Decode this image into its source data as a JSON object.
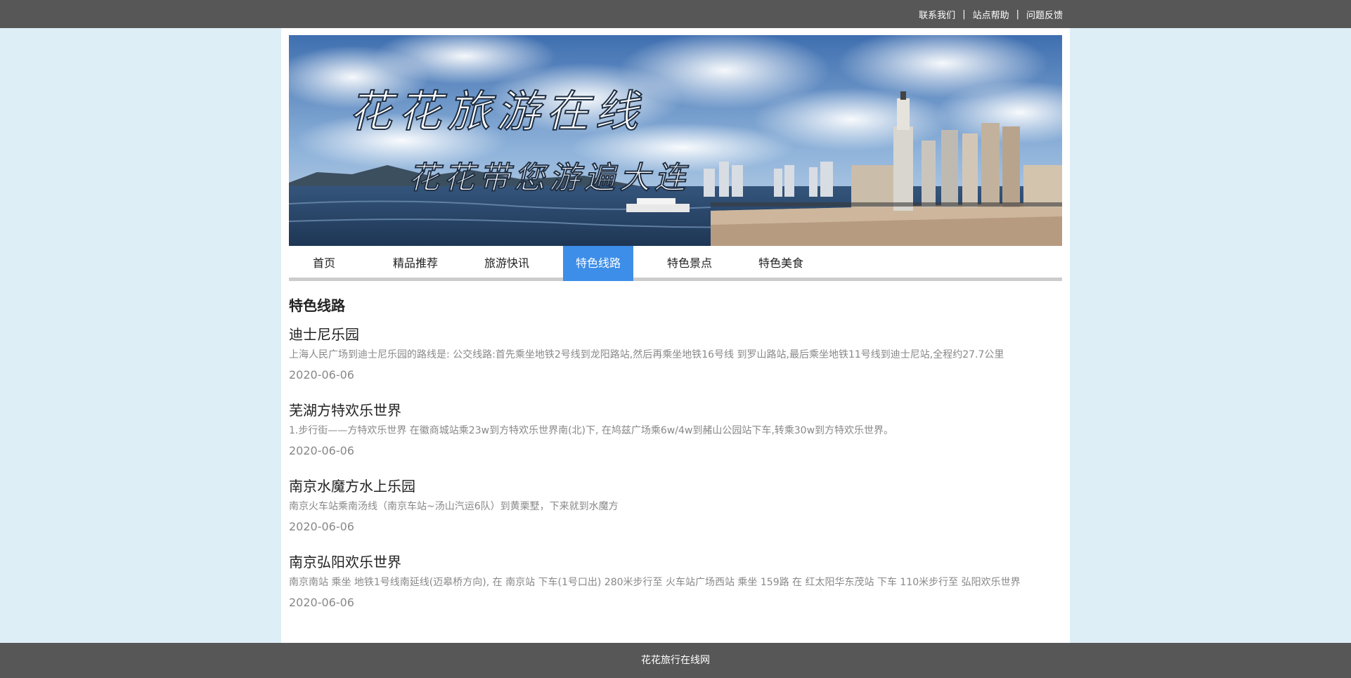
{
  "topbar": {
    "links": [
      "联系我们",
      "站点帮助",
      "问题反馈"
    ],
    "separator": "|"
  },
  "banner": {
    "title": "花花旅游在线",
    "subtitle": "花花带您游遍大连"
  },
  "nav": {
    "items": [
      "首页",
      "精品推荐",
      "旅游快讯",
      "特色线路",
      "特色景点",
      "特色美食"
    ],
    "active_index": 3,
    "active_color": "#3d8ee8"
  },
  "main": {
    "section_title": "特色线路",
    "articles": [
      {
        "title": "迪士尼乐园",
        "summary": "上海人民广场到迪士尼乐园的路线是: 公交线路:首先乘坐地铁2号线到龙阳路站,然后再乘坐地铁16号线 到罗山路站,最后乘坐地铁11号线到迪士尼站,全程约27.7公里",
        "date": "2020-06-06"
      },
      {
        "title": "芜湖方特欢乐世界",
        "summary": "1.步行街——方特欢乐世界 在徽商城站乘23w到方特欢乐世界南(北)下, 在鸠兹广场乘6w/4w到赭山公园站下车,转乘30w到方特欢乐世界。",
        "date": "2020-06-06"
      },
      {
        "title": "南京水魔方水上乐园",
        "summary": "南京火车站乘南汤线（南京车站~汤山汽运6队）到黄栗墅，下来就到水魔方",
        "date": "2020-06-06"
      },
      {
        "title": "南京弘阳欢乐世界",
        "summary": "南京南站 乘坐 地铁1号线南延线(迈皋桥方向), 在 南京站 下车(1号口出) 280米步行至 火车站广场西站 乘坐 159路 在 红太阳华东茂站 下车 110米步行至 弘阳欢乐世界",
        "date": "2020-06-06"
      }
    ]
  },
  "footer": {
    "text": "花花旅行在线网"
  }
}
